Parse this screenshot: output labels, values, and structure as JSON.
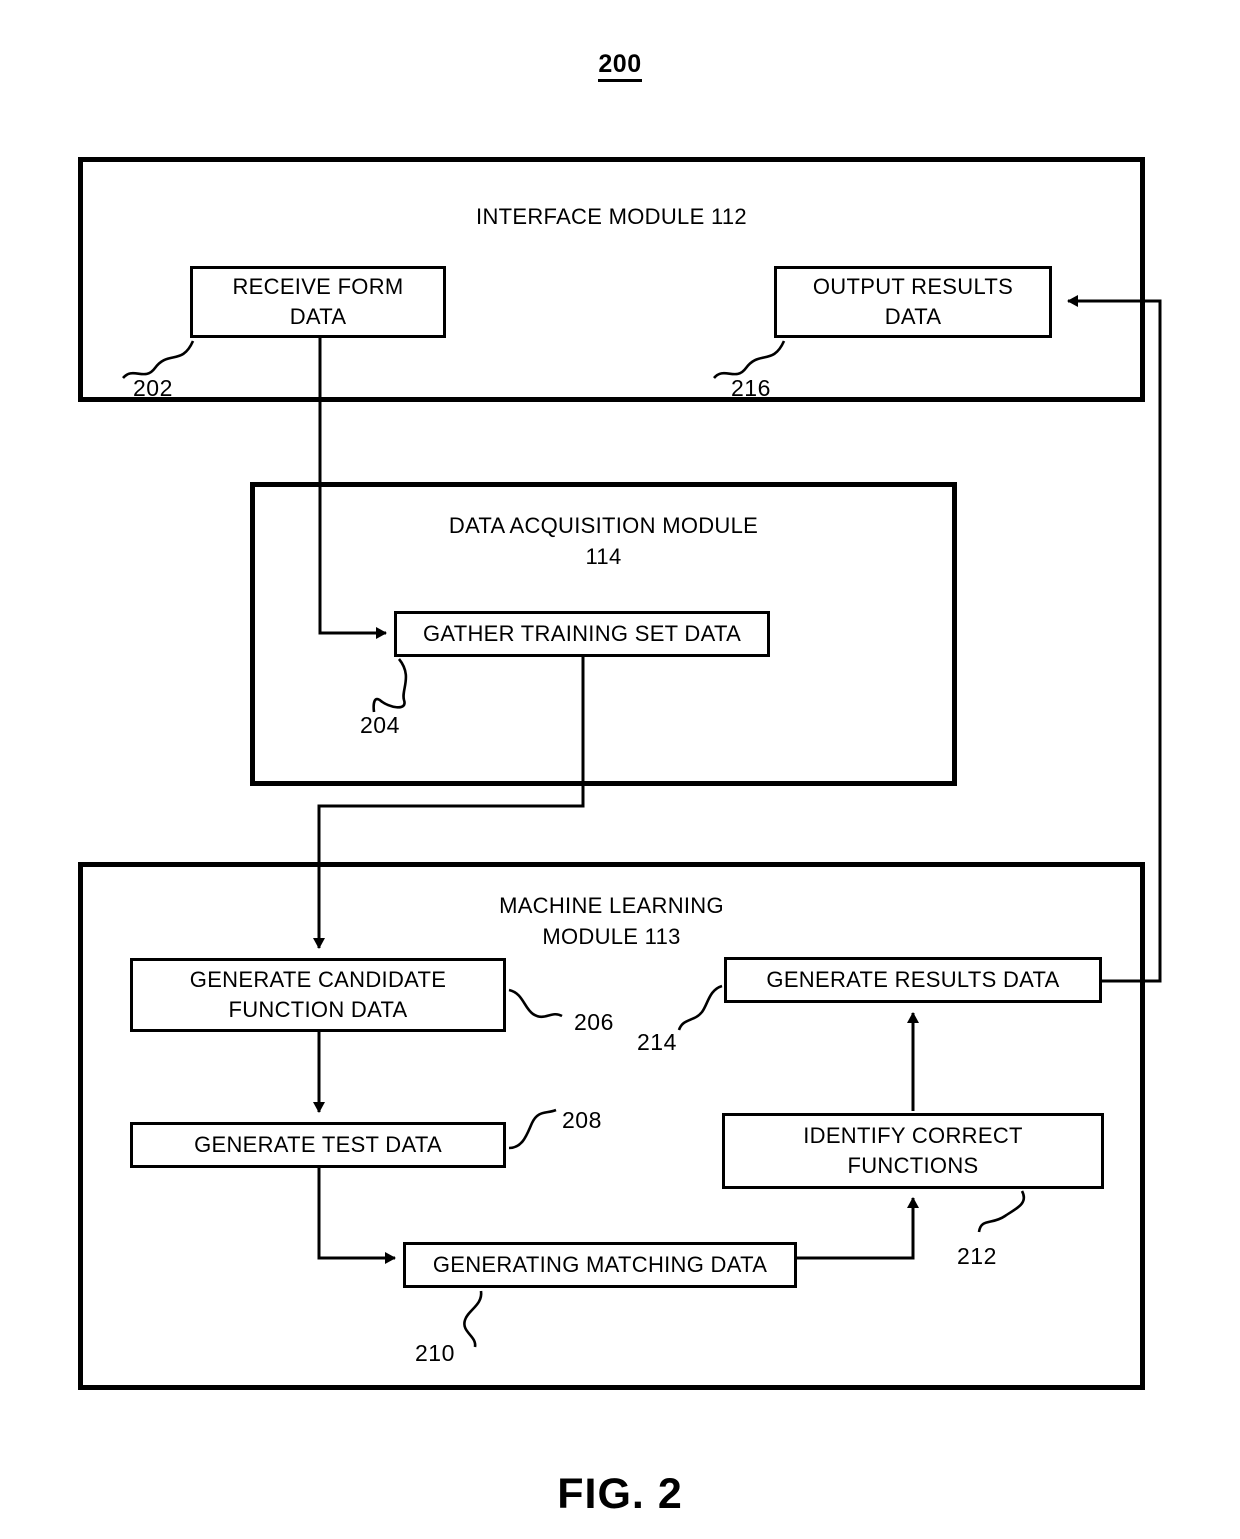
{
  "figure": {
    "number": "200",
    "caption": "FIG. 2"
  },
  "colors": {
    "line": "#000000",
    "background": "#ffffff"
  },
  "modules": [
    {
      "id": "interface-module",
      "title": "INTERFACE MODULE 112"
    },
    {
      "id": "data-acquisition-module",
      "title": "DATA ACQUISITION MODULE\n114"
    },
    {
      "id": "machine-learning-module",
      "title": "MACHINE LEARNING\nMODULE 113"
    }
  ],
  "steps": [
    {
      "id": "receive-form-data",
      "label": "RECEIVE FORM\nDATA",
      "ref": "202"
    },
    {
      "id": "gather-training-set-data",
      "label": "GATHER TRAINING SET DATA",
      "ref": "204"
    },
    {
      "id": "generate-candidate-function-data",
      "label": "GENERATE CANDIDATE\nFUNCTION DATA",
      "ref": "206"
    },
    {
      "id": "generate-test-data",
      "label": "GENERATE TEST DATA",
      "ref": "208"
    },
    {
      "id": "generating-matching-data",
      "label": "GENERATING MATCHING DATA",
      "ref": "210"
    },
    {
      "id": "identify-correct-functions",
      "label": "IDENTIFY CORRECT\nFUNCTIONS",
      "ref": "212"
    },
    {
      "id": "generate-results-data",
      "label": "GENERATE RESULTS DATA",
      "ref": "214"
    },
    {
      "id": "output-results-data",
      "label": "OUTPUT RESULTS\nDATA",
      "ref": "216"
    }
  ],
  "chart_data": {
    "type": "diagram",
    "title": "200",
    "flow": [
      {
        "from": "receive-form-data",
        "to": "gather-training-set-data"
      },
      {
        "from": "gather-training-set-data",
        "to": "generate-candidate-function-data"
      },
      {
        "from": "generate-candidate-function-data",
        "to": "generate-test-data"
      },
      {
        "from": "generate-test-data",
        "to": "generating-matching-data"
      },
      {
        "from": "generating-matching-data",
        "to": "identify-correct-functions"
      },
      {
        "from": "identify-correct-functions",
        "to": "generate-results-data"
      },
      {
        "from": "generate-results-data",
        "to": "output-results-data"
      }
    ]
  }
}
